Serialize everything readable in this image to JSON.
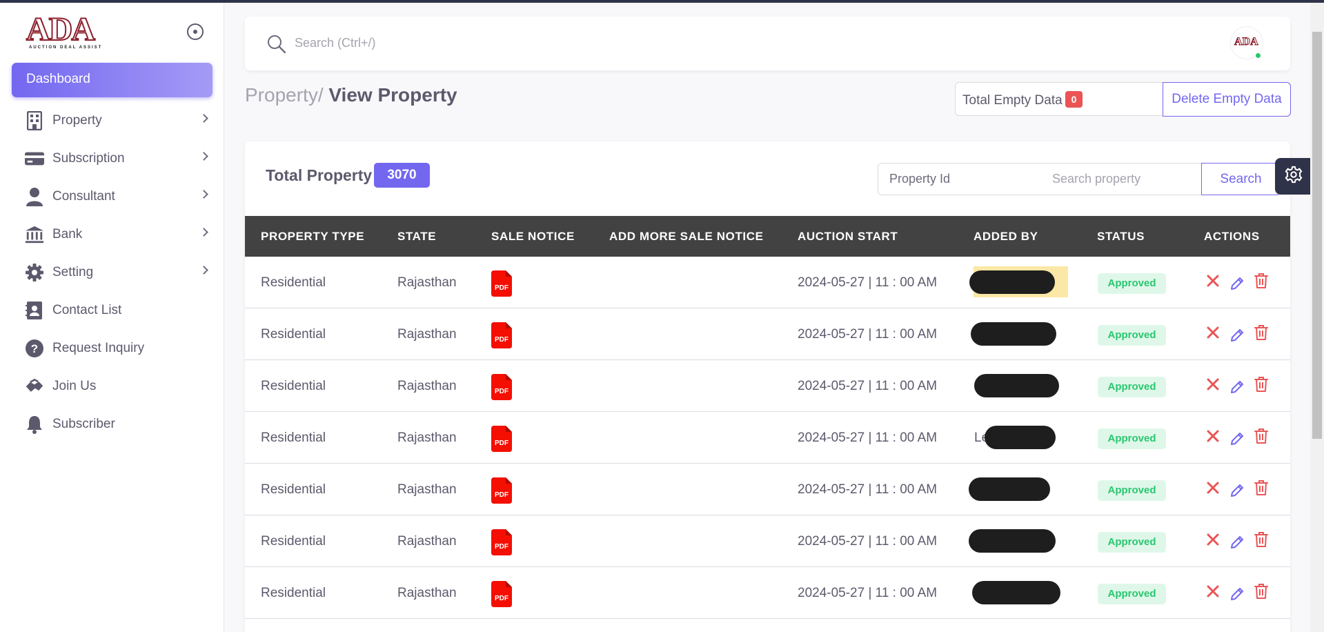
{
  "brand": {
    "logo_text": "ADA",
    "logo_subtitle": "AUCTION DEAL ASSIST"
  },
  "sidebar": {
    "items": [
      {
        "label": "Dashboard",
        "icon": "dashboard-icon",
        "active": true
      },
      {
        "label": "Property",
        "icon": "building-icon",
        "has_submenu": true
      },
      {
        "label": "Subscription",
        "icon": "credit-card-icon",
        "has_submenu": true
      },
      {
        "label": "Consultant",
        "icon": "user-icon",
        "has_submenu": true
      },
      {
        "label": "Bank",
        "icon": "bank-icon",
        "has_submenu": true
      },
      {
        "label": "Setting",
        "icon": "gear-icon",
        "has_submenu": true
      },
      {
        "label": "Contact List",
        "icon": "contact-book-icon"
      },
      {
        "label": "Request Inquiry",
        "icon": "question-icon"
      },
      {
        "label": "Join Us",
        "icon": "handshake-icon"
      },
      {
        "label": "Subscriber",
        "icon": "bell-icon"
      }
    ]
  },
  "header": {
    "search_placeholder": "Search (Ctrl+/)",
    "avatar_text": "ADA",
    "status": "online"
  },
  "breadcrumb": {
    "parent": "Property/",
    "current": "View Property"
  },
  "empty_data": {
    "label": "Total Empty Data",
    "count": "0",
    "delete_label": "Delete Empty Data"
  },
  "card": {
    "total_label": "Total Property",
    "total_count": "3070",
    "property_id_placeholder": "Property Id",
    "search_placeholder": "Search property",
    "search_label": "Search"
  },
  "table": {
    "columns": [
      "PROPERTY TYPE",
      "STATE",
      "SALE NOTICE",
      "ADD MORE SALE NOTICE",
      "AUCTION START",
      "ADDED BY",
      "STATUS",
      "ACTIONS"
    ],
    "rows": [
      {
        "type": "Residential",
        "state": "Rajasthan",
        "sale_notice": "PDF",
        "auction_start": "2024-05-27 | 11 : 00 AM",
        "added_by_prefix": "",
        "status": "Approved"
      },
      {
        "type": "Residential",
        "state": "Rajasthan",
        "sale_notice": "PDF",
        "auction_start": "2024-05-27 | 11 : 00 AM",
        "added_by_prefix": "",
        "status": "Approved"
      },
      {
        "type": "Residential",
        "state": "Rajasthan",
        "sale_notice": "PDF",
        "auction_start": "2024-05-27 | 11 : 00 AM",
        "added_by_prefix": "",
        "status": "Approved"
      },
      {
        "type": "Residential",
        "state": "Rajasthan",
        "sale_notice": "PDF",
        "auction_start": "2024-05-27 | 11 : 00 AM",
        "added_by_prefix": "Le",
        "status": "Approved"
      },
      {
        "type": "Residential",
        "state": "Rajasthan",
        "sale_notice": "PDF",
        "auction_start": "2024-05-27 | 11 : 00 AM",
        "added_by_prefix": "",
        "status": "Approved"
      },
      {
        "type": "Residential",
        "state": "Rajasthan",
        "sale_notice": "PDF",
        "auction_start": "2024-05-27 | 11 : 00 AM",
        "added_by_prefix": "",
        "status": "Approved"
      },
      {
        "type": "Residential",
        "state": "Rajasthan",
        "sale_notice": "PDF",
        "auction_start": "2024-05-27 | 11 : 00 AM",
        "added_by_prefix": "",
        "status": "Approved"
      }
    ]
  },
  "colors": {
    "primary": "#7367f0",
    "danger": "#ea5455",
    "success": "#28c76f",
    "table_header": "#424242"
  }
}
